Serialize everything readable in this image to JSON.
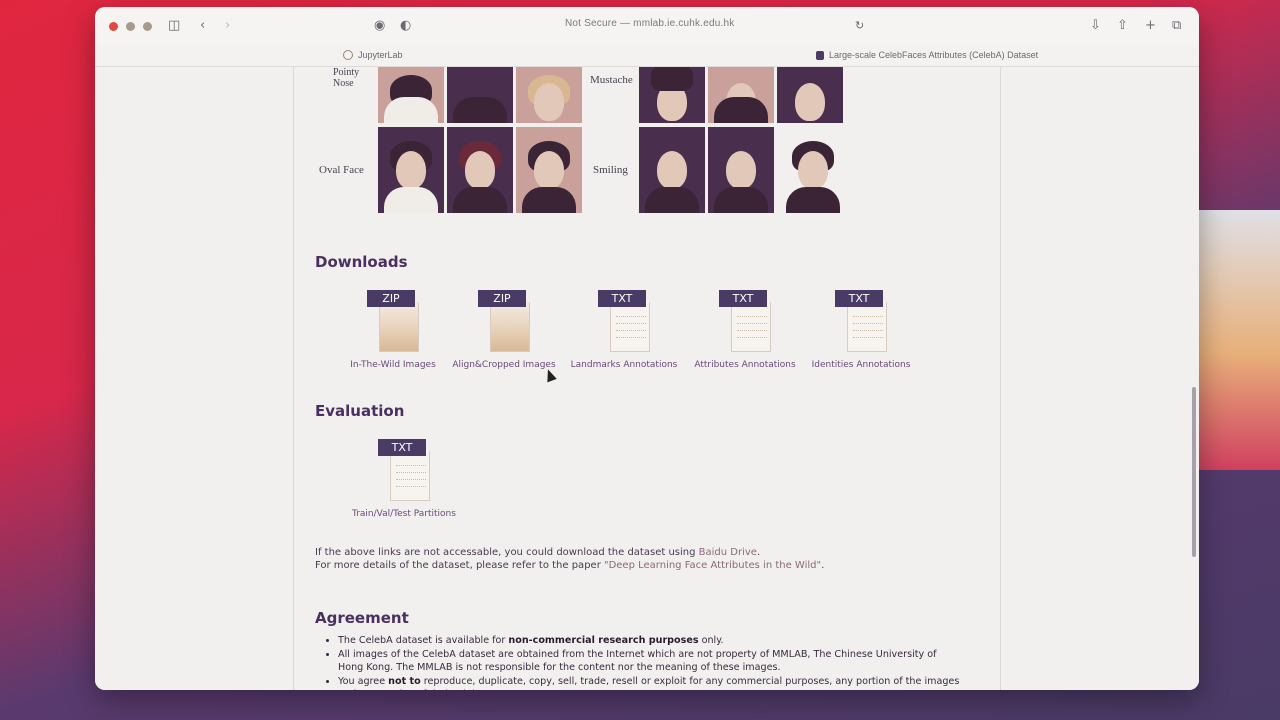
{
  "browser": {
    "address": "Not Secure — mmlab.ie.cuhk.edu.hk",
    "tabs": [
      {
        "label": "JupyterLab"
      },
      {
        "label": "Large-scale CelebFaces Attributes (CelebA) Dataset"
      }
    ]
  },
  "attribute_rows": {
    "row1_left_label_a": "Pointy",
    "row1_left_label_b": "Nose",
    "row1_right_label": "Mustache",
    "row2_left_label": "Oval Face",
    "row2_right_label": "Smiling"
  },
  "downloads": {
    "heading": "Downloads",
    "items": [
      {
        "badge": "ZIP",
        "label": "In-The-Wild Images"
      },
      {
        "badge": "ZIP",
        "label": "Align&Cropped Images"
      },
      {
        "badge": "TXT",
        "label": "Landmarks Annotations"
      },
      {
        "badge": "TXT",
        "label": "Attributes Annotations"
      },
      {
        "badge": "TXT",
        "label": "Identities Annotations"
      }
    ]
  },
  "evaluation": {
    "heading": "Evaluation",
    "items": [
      {
        "badge": "TXT",
        "label": "Train/Val/Test Partitions"
      }
    ]
  },
  "notes": {
    "line1_prefix": "If the above links are not accessable, you could download the dataset using ",
    "line1_link": "Baidu Drive",
    "line1_suffix": ".",
    "line2_prefix": "For more details of the dataset, please refer to the paper ",
    "line2_link": "\"Deep Learning Face Attributes in the Wild\"",
    "line2_suffix": "."
  },
  "agreement": {
    "heading": "Agreement",
    "item1_prefix": "The CelebA dataset is available for ",
    "item1_bold": "non-commercial research purposes",
    "item1_suffix": " only.",
    "item2": "All images of the CelebA dataset are obtained from the Internet which are not property of MMLAB, The Chinese University of Hong Kong. The MMLAB is not responsible for the content nor the meaning of these images.",
    "item3_prefix": "You agree ",
    "item3_bold": "not to",
    "item3_suffix": " reproduce, duplicate, copy, sell, trade, resell or exploit for any commercial purposes, any portion of the images and any portion of derived data."
  }
}
